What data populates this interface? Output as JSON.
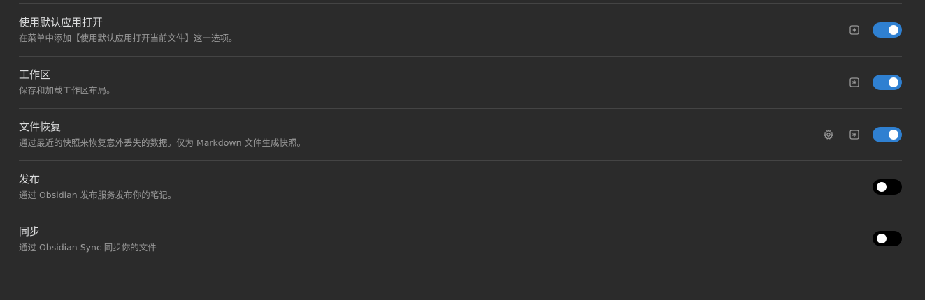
{
  "plugins": [
    {
      "title": "使用默认应用打开",
      "description": "在菜单中添加【使用默认应用打开当前文件】这一选项。",
      "has_settings": false,
      "has_hotkeys": true,
      "enabled": true
    },
    {
      "title": "工作区",
      "description": "保存和加载工作区布局。",
      "has_settings": false,
      "has_hotkeys": true,
      "enabled": true
    },
    {
      "title": "文件恢复",
      "description": "通过最近的快照来恢复意外丢失的数据。仅为 Markdown 文件生成快照。",
      "has_settings": true,
      "has_hotkeys": true,
      "enabled": true
    },
    {
      "title": "发布",
      "description": "通过 Obsidian 发布服务发布你的笔记。",
      "has_settings": false,
      "has_hotkeys": false,
      "enabled": false
    },
    {
      "title": "同步",
      "description": "通过 Obsidian Sync 同步你的文件",
      "has_settings": false,
      "has_hotkeys": false,
      "enabled": false
    }
  ],
  "icons": {
    "settings": "gear-icon",
    "hotkeys": "hotkey-icon"
  },
  "colors": {
    "background": "#2b2b2b",
    "toggle_on": "#2f80d1",
    "toggle_off": "#000000",
    "divider": "#444444",
    "title_text": "#dcddde",
    "desc_text": "#999999",
    "icon": "#9a9a9a"
  }
}
